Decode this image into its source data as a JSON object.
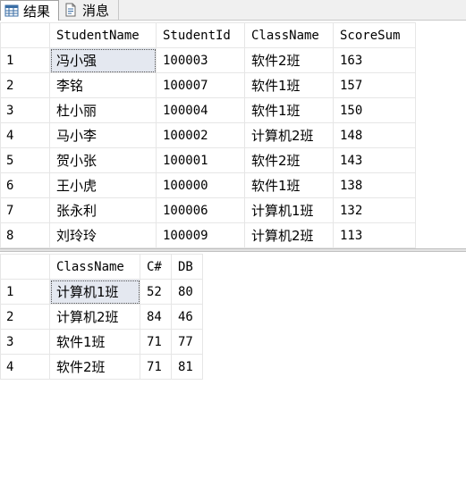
{
  "tabs": [
    {
      "label": "结果",
      "icon": "grid-results-icon",
      "active": true
    },
    {
      "label": "消息",
      "icon": "messages-icon",
      "active": false
    }
  ],
  "results1": {
    "columns": [
      "StudentName",
      "StudentId",
      "ClassName",
      "ScoreSum"
    ],
    "rows": [
      {
        "num": "1",
        "cells": [
          "冯小强",
          "100003",
          "软件2班",
          "163"
        ]
      },
      {
        "num": "2",
        "cells": [
          "李铭",
          "100007",
          "软件1班",
          "157"
        ]
      },
      {
        "num": "3",
        "cells": [
          "杜小丽",
          "100004",
          "软件1班",
          "150"
        ]
      },
      {
        "num": "4",
        "cells": [
          "马小李",
          "100002",
          "计算机2班",
          "148"
        ]
      },
      {
        "num": "5",
        "cells": [
          "贺小张",
          "100001",
          "软件2班",
          "143"
        ]
      },
      {
        "num": "6",
        "cells": [
          "王小虎",
          "100000",
          "软件1班",
          "138"
        ]
      },
      {
        "num": "7",
        "cells": [
          "张永利",
          "100006",
          "计算机1班",
          "132"
        ]
      },
      {
        "num": "8",
        "cells": [
          "刘玲玲",
          "100009",
          "计算机2班",
          "113"
        ]
      }
    ]
  },
  "results2": {
    "columns": [
      "ClassName",
      "C#",
      "DB"
    ],
    "rows": [
      {
        "num": "1",
        "cells": [
          "计算机1班",
          "52",
          "80"
        ]
      },
      {
        "num": "2",
        "cells": [
          "计算机2班",
          "84",
          "46"
        ]
      },
      {
        "num": "3",
        "cells": [
          "软件1班",
          "71",
          "77"
        ]
      },
      {
        "num": "4",
        "cells": [
          "软件2班",
          "71",
          "81"
        ]
      }
    ]
  },
  "colors": {
    "selected_cell": "#e4e8f0",
    "grid_line": "#e6e6e6",
    "tabbar_bg": "#f0f0f0"
  }
}
